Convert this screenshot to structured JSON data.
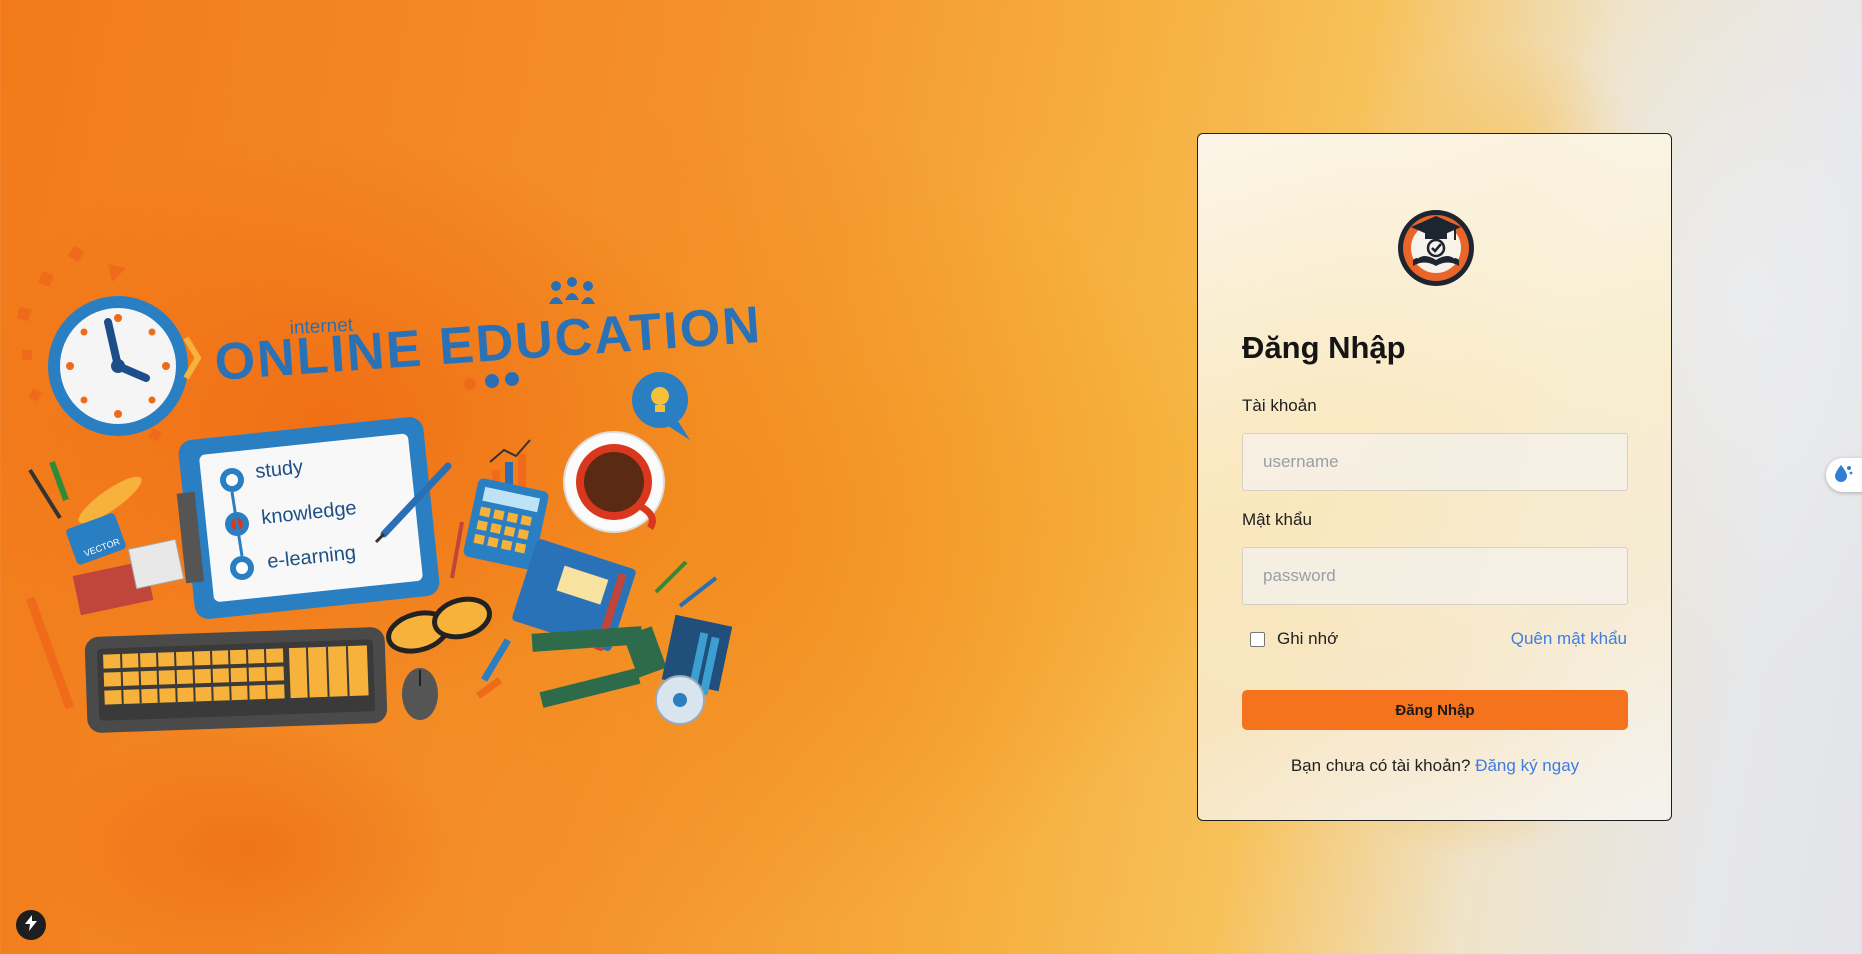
{
  "banner": {
    "small_text": "internet",
    "headline": "ONLINE EDUCATION",
    "clipboard_items": [
      "study",
      "knowledge",
      "e-learning"
    ],
    "card_text": "VECTOR"
  },
  "login": {
    "title": "Đăng Nhập",
    "username_label": "Tài khoản",
    "username_placeholder": "username",
    "password_label": "Mật khẩu",
    "password_placeholder": "password",
    "remember_label": "Ghi nhớ",
    "forgot_label": "Quên mật khẩu",
    "submit_label": "Đăng Nhập",
    "signup_prompt": "Bạn chưa có tài khoản?",
    "signup_link": "Đăng ký ngay"
  },
  "colors": {
    "accent": "#f4731c",
    "link": "#3f7de0",
    "headline_blue": "#1f6fb6"
  },
  "icons": {
    "logo": "graduation-cap-book-icon",
    "side_tab": "water-drop-icon",
    "corner": "lightning-bolt-icon"
  }
}
